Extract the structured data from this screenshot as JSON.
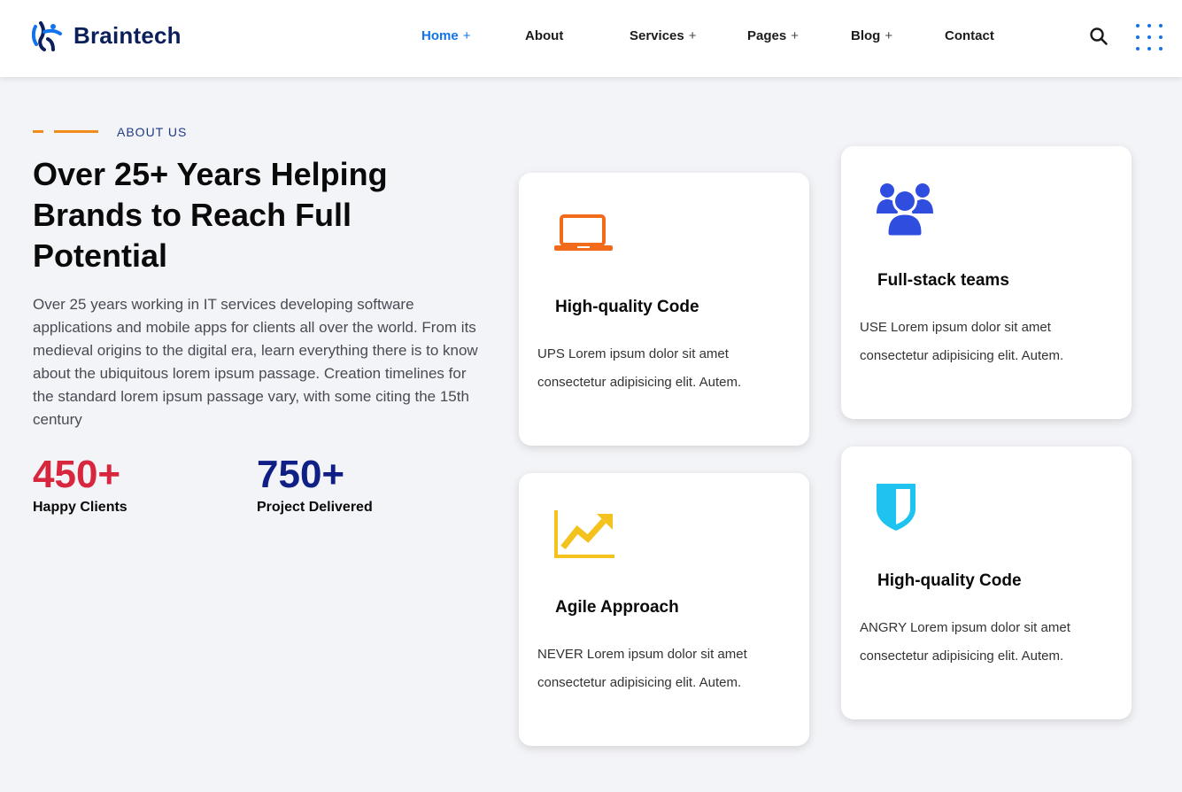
{
  "brand": {
    "name": "Braintech"
  },
  "nav": {
    "items": [
      {
        "label": "Home",
        "plus": "+"
      },
      {
        "label": "About"
      },
      {
        "label": "Services",
        "plus": "+"
      },
      {
        "label": "Pages",
        "plus": "+"
      },
      {
        "label": "Blog",
        "plus": "+"
      },
      {
        "label": "Contact"
      }
    ],
    "active": "Home"
  },
  "about": {
    "tag": "ABOUT US",
    "heading": "Over 25+ Years Helping Brands to Reach Full Potential",
    "description": "Over 25 years working in IT services developing software applications and mobile apps for clients all over the world. From its medieval origins to the digital era, learn everything there is to know about the ubiquitous lorem ipsum passage. Creation timelines for the standard lorem ipsum passage vary, with some citing the 15th century",
    "stats": [
      {
        "value": "450+",
        "label": "Happy Clients"
      },
      {
        "value": "750+",
        "label": "Project Delivered"
      }
    ]
  },
  "cards": [
    {
      "icon": "laptop-icon",
      "title": "High-quality Code",
      "text": "UPS Lorem ipsum dolor sit amet consectetur adipisicing elit. Autem."
    },
    {
      "icon": "users-icon",
      "title": "Full-stack teams",
      "text": "USE Lorem ipsum dolor sit amet consectetur adipisicing elit. Autem."
    },
    {
      "icon": "chart-growth-icon",
      "title": "Agile Approach",
      "text": "NEVER Lorem ipsum dolor sit amet consectetur adipisicing elit. Autem."
    },
    {
      "icon": "shield-icon",
      "title": "High-quality Code",
      "text": "ANGRY Lorem ipsum dolor sit amet consectetur adipisicing elit. Autem."
    }
  ],
  "colors": {
    "primary": "#1273eb",
    "accent_orange": "#f28b1c",
    "stat_red": "#d7263d",
    "stat_navy": "#0f1f86",
    "laptop_icon": "#f26a1b",
    "users_icon": "#2f4ee0",
    "chart_icon": "#f4c21c",
    "shield_icon": "#1ec4ef"
  }
}
